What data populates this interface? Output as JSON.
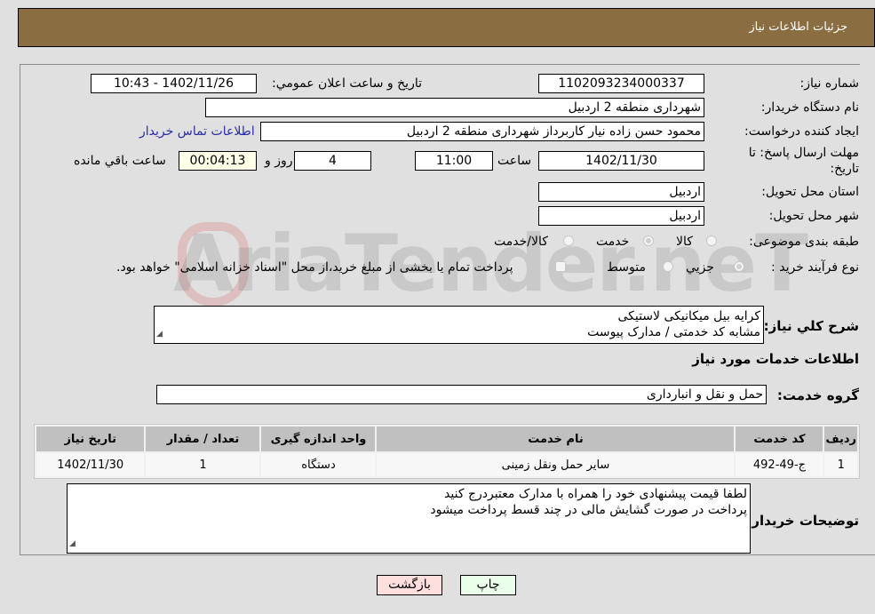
{
  "header": {
    "title": "جزئیات اطلاعات نیاز"
  },
  "fields": {
    "need_number_label": "شماره نیاز:",
    "need_number": "1102093234000337",
    "announce_label": "تاریخ و ساعت اعلان عمومي:",
    "announce_value": "1402/11/26 - 10:43",
    "buyer_org_label": "نام دستگاه خریدار:",
    "buyer_org": "شهرداری منطقه 2 اردبیل",
    "creator_label": "ایجاد کننده درخواست:",
    "creator": "محمود حسن زاده نیار کاربرداز شهرداری منطقه 2 اردبیل",
    "contact_link": "اطلاعات تماس خریدار",
    "deadline_label_1": "مهلت ارسال پاسخ: تا",
    "deadline_label_2": "تاریخ:",
    "deadline_date": "1402/11/30",
    "time_label": "ساعت",
    "deadline_time": "11:00",
    "days_value": "4",
    "days_label": "روز و",
    "remaining_time": "00:04:13",
    "remaining_label": "ساعت باقي مانده",
    "province_label": "استان محل تحویل:",
    "province": "اردبیل",
    "city_label": "شهر محل تحویل:",
    "city": "اردبیل",
    "category_label": "طبقه بندی موضوعی:",
    "category_options": [
      "کالا",
      "خدمت",
      "کالا/خدمت"
    ],
    "category_selected": "خدمت",
    "process_label": "نوع فرآیند خرید :",
    "process_options": [
      "جزيي",
      "متوسط"
    ],
    "process_selected": "جزيي",
    "treasury_note": "پرداخت تمام یا بخشی از مبلغ خرید،از محل \"اسناد خزانه اسلامی\" خواهد بود."
  },
  "description": {
    "label": "شرح کلي نیاز:",
    "lines": [
      "کرایه بیل میکانیکی  لاستیکی",
      "مشابه کد خدمتی / مدارک پیوست"
    ]
  },
  "services_section_title": "اطلاعات خدمات مورد نیاز",
  "service_group": {
    "label": "گروه خدمت:",
    "value": "حمل و نقل و انبارداری"
  },
  "table": {
    "headers": [
      "ردیف",
      "کد خدمت",
      "نام خدمت",
      "واحد اندازه گیری",
      "تعداد / مقدار",
      "تاریخ نیاز"
    ],
    "rows": [
      [
        "1",
        "ج-49-492",
        "سایر حمل ونقل زمینی",
        "دستگاه",
        "1",
        "1402/11/30"
      ]
    ]
  },
  "buyer_notes": {
    "label": "توضیحات خریدار:",
    "lines": [
      "لطفا قیمت پیشنهادی خود را همراه با مدارک معتبردرج کنید",
      "پرداخت در صورت گشایش مالی در چند قسط پرداخت میشود"
    ]
  },
  "buttons": {
    "back": "بازگشت",
    "print": "چاپ"
  },
  "watermark": "AriaTender.neT"
}
